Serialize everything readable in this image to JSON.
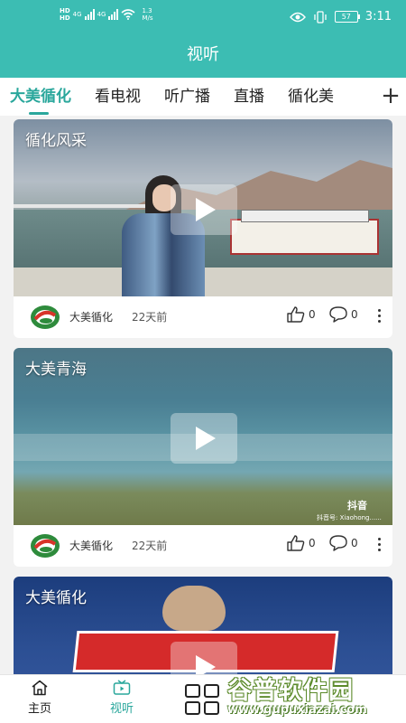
{
  "status_bar": {
    "sim1": "HD",
    "sim2": "HD",
    "net1": "4G",
    "net2": "4G",
    "speed_value": "1.3",
    "speed_unit": "M/s",
    "battery": "57",
    "time": "3:11"
  },
  "header": {
    "title": "视听"
  },
  "tabs": [
    {
      "label": "大美循化",
      "active": true
    },
    {
      "label": "看电视"
    },
    {
      "label": "听广播"
    },
    {
      "label": "直播"
    },
    {
      "label": "循化美"
    }
  ],
  "tab_add_label": "+",
  "cards": [
    {
      "title": "循化风采",
      "author": "大美循化",
      "time": "22天前",
      "likes": "0",
      "comments": "0"
    },
    {
      "title": "大美青海",
      "author": "大美循化",
      "time": "22天前",
      "likes": "0",
      "comments": "0",
      "watermark_brand": "抖音",
      "watermark_id": "抖音号: Xiaohong......"
    },
    {
      "title": "大美循化"
    }
  ],
  "bottom_nav": [
    {
      "label": "主页",
      "icon": "home-icon"
    },
    {
      "label": "视听",
      "icon": "tv-icon",
      "active": true
    },
    {
      "label": "",
      "icon": "grid-icon"
    }
  ],
  "site_watermark": {
    "title": "谷普软件园",
    "url": "www.gupuxiazai.com"
  },
  "colors": {
    "brand": "#3cbdb3",
    "accent": "#2aa79c"
  }
}
